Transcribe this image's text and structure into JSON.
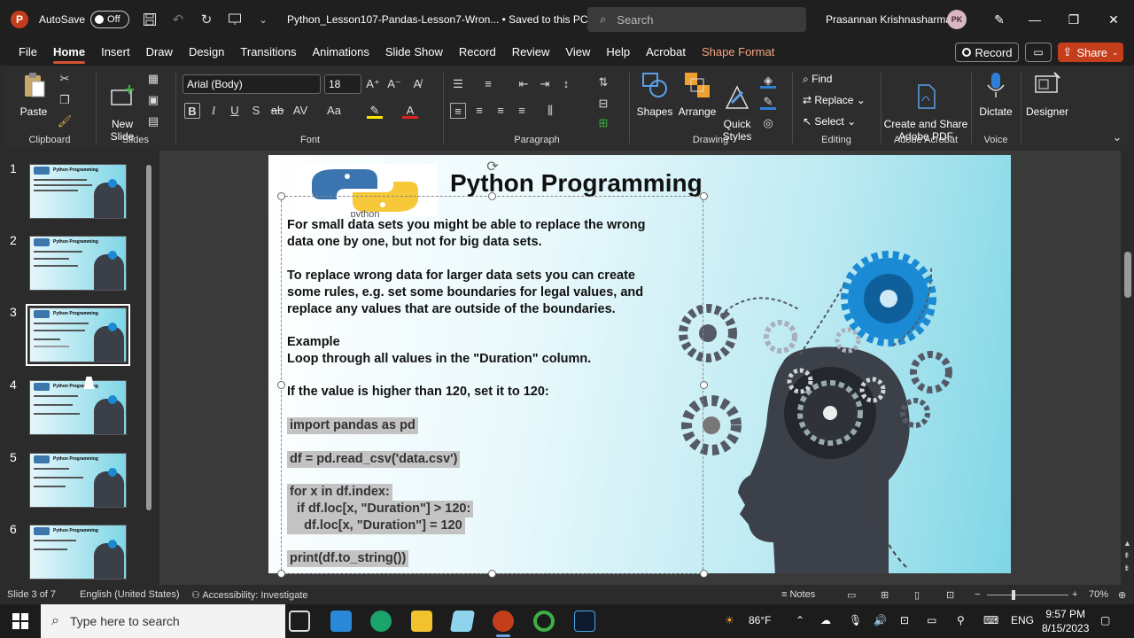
{
  "titlebar": {
    "autosave_label": "AutoSave",
    "autosave_state": "Off",
    "doc_title": "Python_Lesson107-Pandas-Lesson7-Wron...  •  Saved to this PC  ⌄",
    "search_placeholder": "Search",
    "user_name": "Prasannan Krishnasharma",
    "user_initials": "PK"
  },
  "menu": {
    "items": [
      "File",
      "Home",
      "Insert",
      "Draw",
      "Design",
      "Transitions",
      "Animations",
      "Slide Show",
      "Record",
      "Review",
      "View",
      "Help",
      "Acrobat",
      "Shape Format"
    ],
    "record_label": "Record",
    "share_label": "Share"
  },
  "ribbon": {
    "clipboard": {
      "label": "Clipboard",
      "paste": "Paste"
    },
    "slides": {
      "label": "Slides",
      "new_slide": "New\nSlide"
    },
    "font": {
      "label": "Font",
      "family": "Arial (Body)",
      "size": "18"
    },
    "paragraph": {
      "label": "Paragraph"
    },
    "drawing": {
      "label": "Drawing",
      "shapes": "Shapes",
      "arrange": "Arrange",
      "quick_styles": "Quick\nStyles"
    },
    "editing": {
      "label": "Editing",
      "find": "Find",
      "replace": "Replace",
      "select": "Select"
    },
    "acrobat": {
      "label": "Adobe Acrobat",
      "create": "Create and Share\nAdobe PDF"
    },
    "voice": {
      "label": "Voice",
      "dictate": "Dictate"
    },
    "designer": {
      "label": "Designer"
    }
  },
  "thumbnails": {
    "numbers": [
      "1",
      "2",
      "3",
      "4",
      "5",
      "6"
    ],
    "title": "Python Programming"
  },
  "slide": {
    "title": "Python Programming",
    "logo_text": "python",
    "lines": [
      "For small data sets you might be able to replace the wrong",
      "data one by one, but not for big data sets.",
      "To replace wrong data for larger data sets you can create",
      "some rules, e.g. set some boundaries for legal values, and",
      "replace any values that are outside of the boundaries.",
      "Example",
      "Loop through all values in the \"Duration\" column.",
      "If the value is higher than 120, set it to 120:"
    ],
    "code": [
      "import pandas as pd",
      "df = pd.read_csv('data.csv')",
      "for x in df.index:",
      "  if df.loc[x, \"Duration\"] > 120:",
      "    df.loc[x, \"Duration\"] = 120",
      "print(df.to_string())"
    ]
  },
  "status": {
    "slide_of": "Slide 3 of 7",
    "language": "English (United States)",
    "accessibility": "Accessibility: Investigate",
    "notes": "Notes",
    "zoom": "70%"
  },
  "taskbar": {
    "search_placeholder": "Type here to search",
    "weather": "86°F",
    "lang": "ENG",
    "time": "9:57 PM",
    "date": "8/15/2023"
  },
  "colors": {
    "accent": "#c43e1c",
    "shape_format": "#f4a582",
    "gear_blue": "#1a8ad4"
  }
}
